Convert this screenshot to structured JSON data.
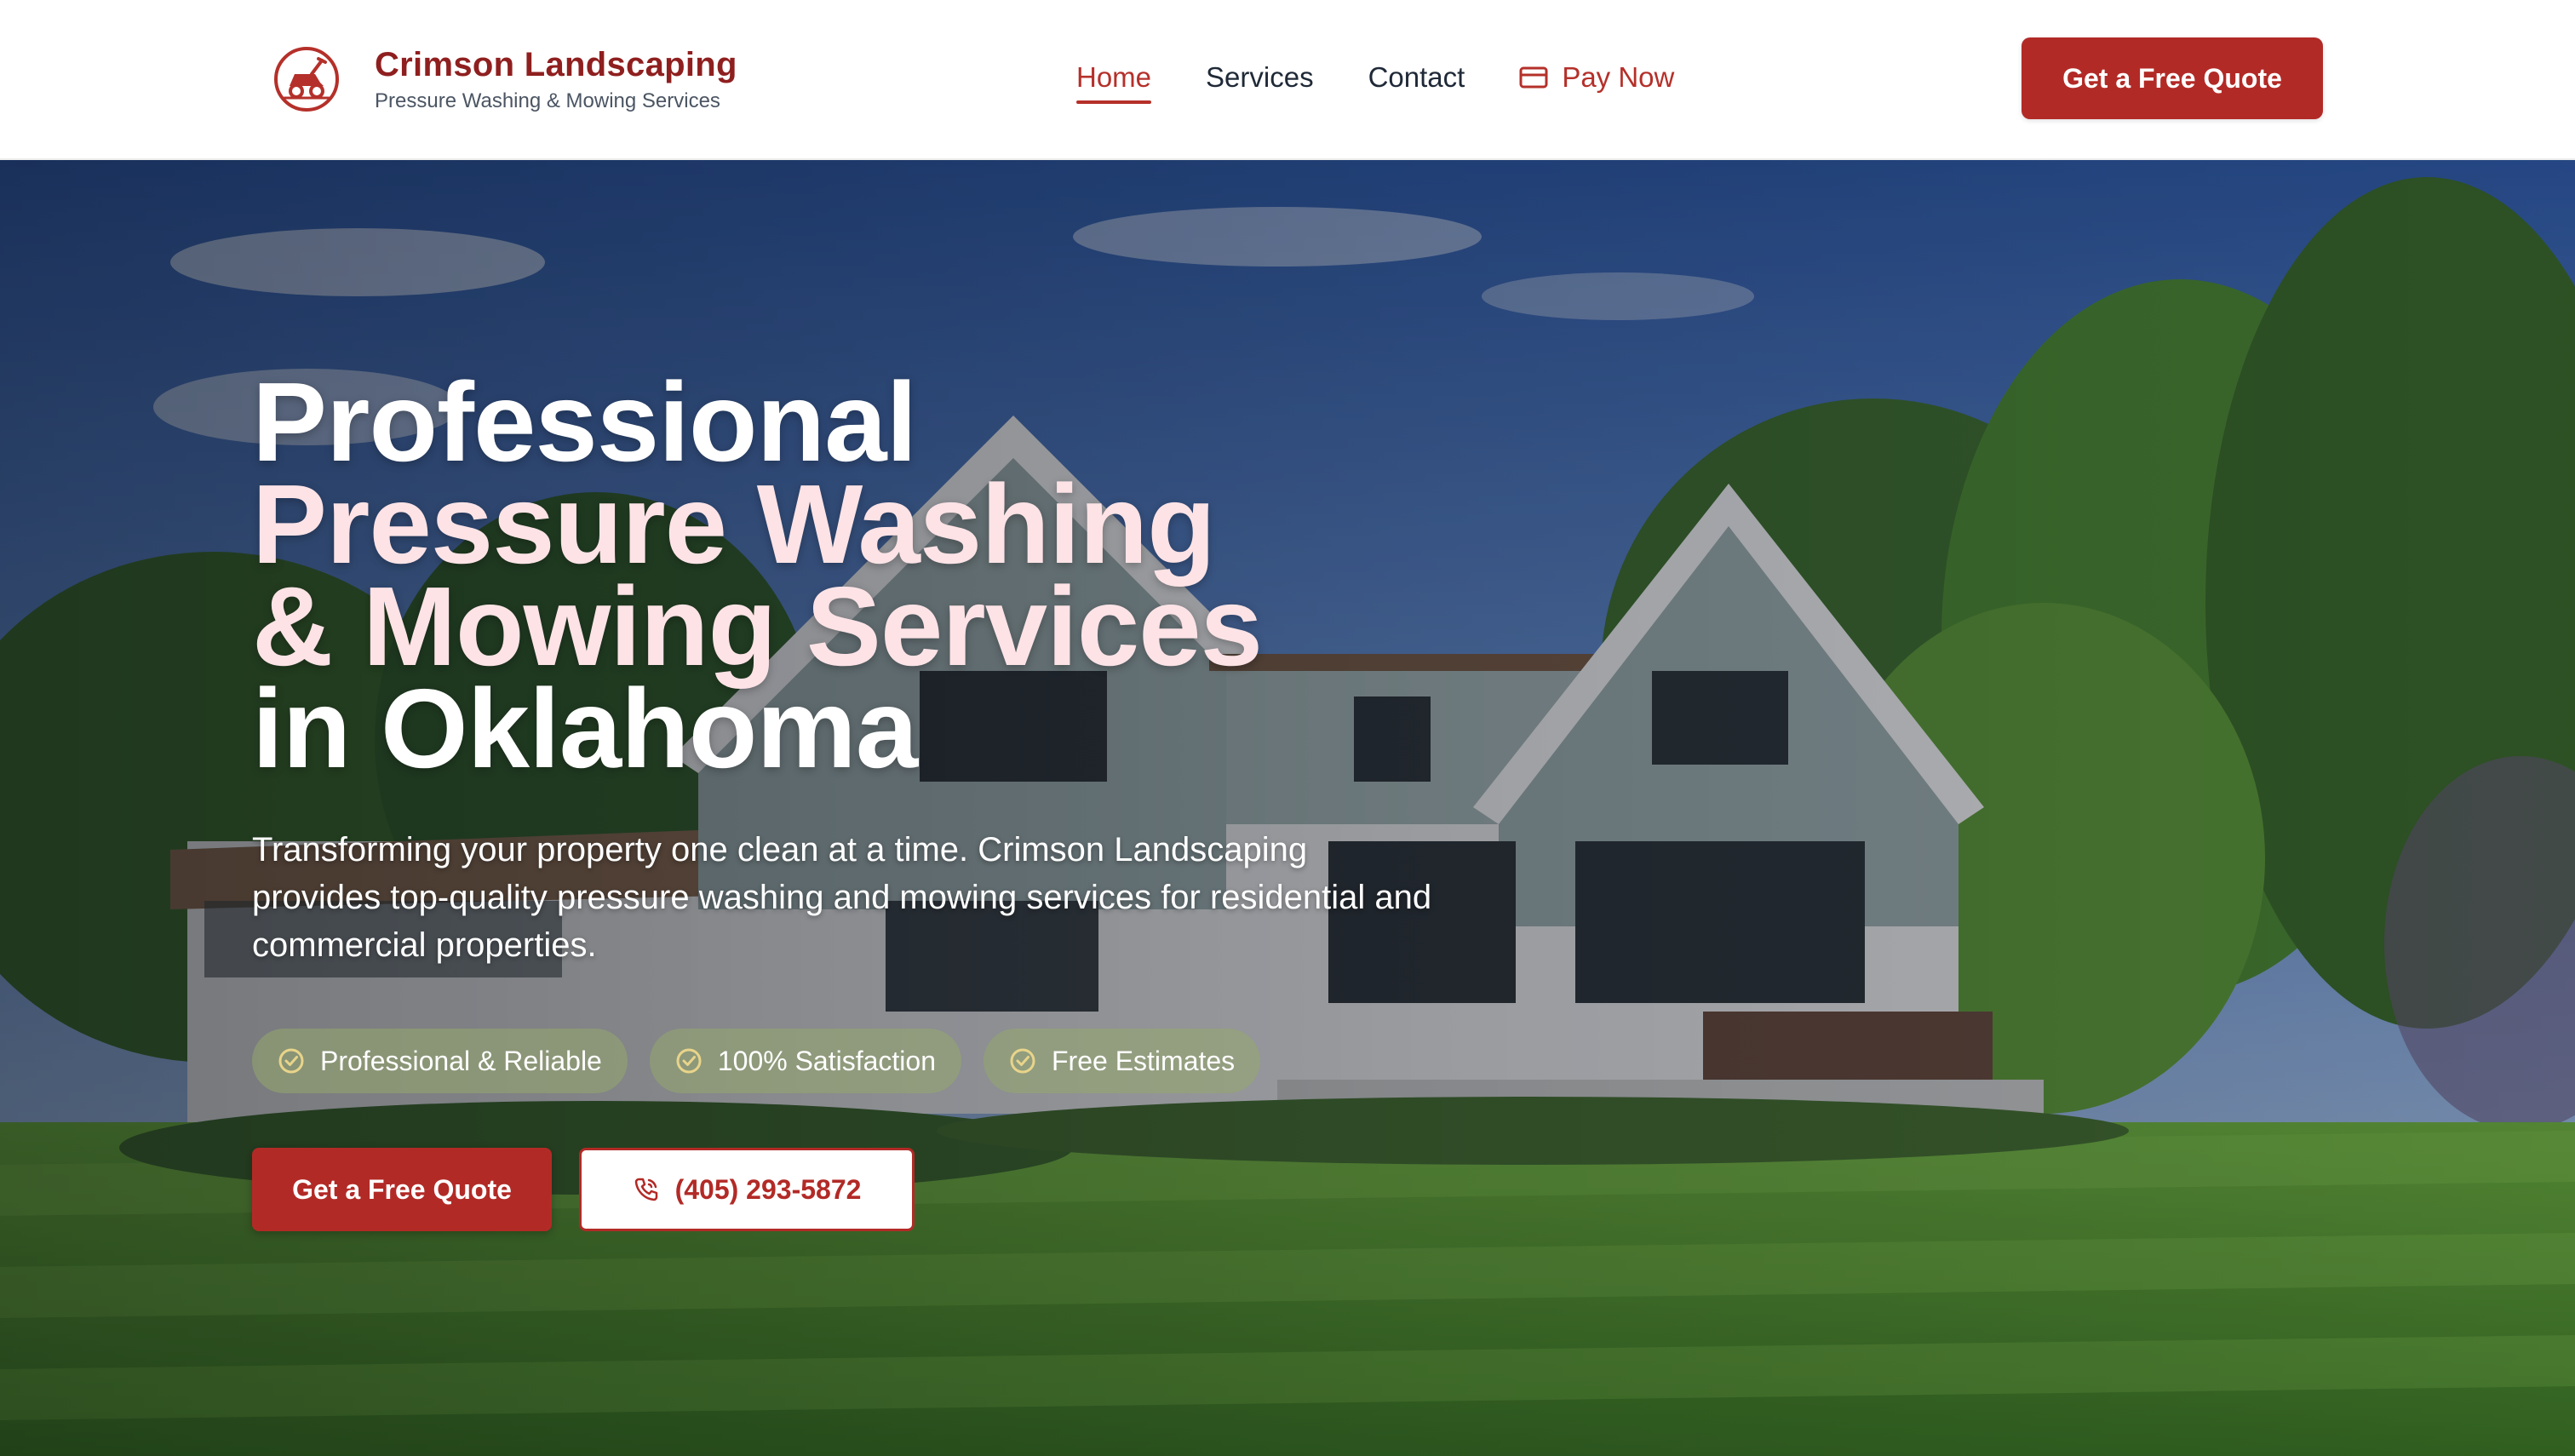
{
  "brand": {
    "name": "Crimson Landscaping",
    "tagline": "Pressure Washing & Mowing Services",
    "logo_icon": "lawn-mower-icon"
  },
  "nav": {
    "items": [
      {
        "label": "Home",
        "active": true
      },
      {
        "label": "Services",
        "active": false
      },
      {
        "label": "Contact",
        "active": false
      }
    ],
    "pay": {
      "label": "Pay Now",
      "icon": "credit-card-icon"
    }
  },
  "header_cta": {
    "label": "Get a Free Quote"
  },
  "hero": {
    "title_lines": [
      "Professional",
      "Pressure Washing",
      "& Mowing Services",
      "in Oklahoma"
    ],
    "description": "Transforming your property one clean at a time. Crimson Landscaping provides top-quality pressure washing and mowing services for residential and commercial properties.",
    "badges": [
      {
        "label": "Professional & Reliable",
        "icon": "check-circle-icon"
      },
      {
        "label": "100% Satisfaction",
        "icon": "check-circle-icon"
      },
      {
        "label": "Free Estimates",
        "icon": "check-circle-icon"
      }
    ],
    "cta_primary": "Get a Free Quote",
    "cta_phone": {
      "label": "(405) 293-5872",
      "icon": "phone-icon"
    }
  },
  "colors": {
    "brand_red": "#b22a26",
    "brand_dark_red": "#8f1f1f",
    "title_pink": "#fde3e6",
    "badge_green": "#96a86e"
  }
}
